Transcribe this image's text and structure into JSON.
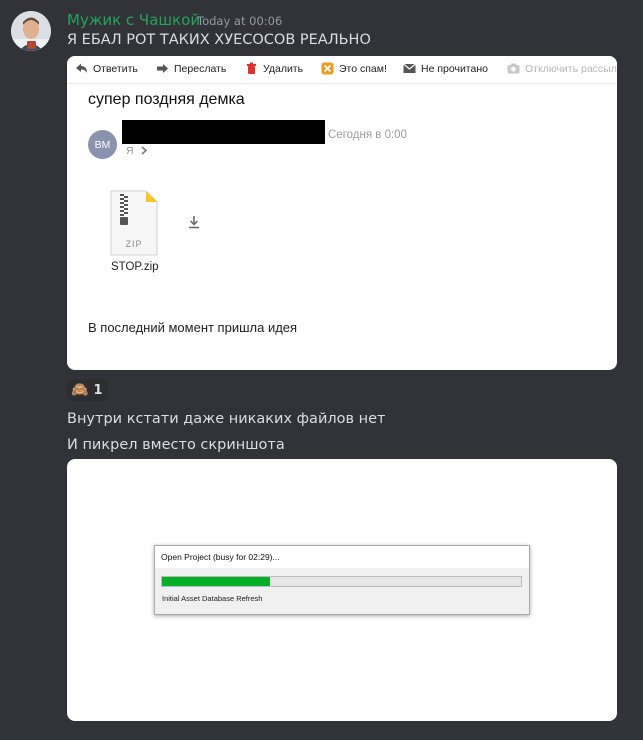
{
  "message": {
    "author": "Мужик с Чашкой",
    "timestamp": "Today at 00:06",
    "text_1": "Я ЕБАЛ РОТ ТАКИХ ХУЕСОСОВ РЕАЛЬНО",
    "text_2": "Внутри кстати даже никаких файлов нет",
    "text_3": "И пикрел вместо скриншота",
    "author_color": "#23a55a"
  },
  "email": {
    "toolbar": {
      "reply": "Ответить",
      "forward": "Переслать",
      "delete": "Удалить",
      "spam": "Это спам!",
      "unread": "Не прочитано",
      "unsubscribe": "Отключить рассыл"
    },
    "subject": "супер поздняя демка",
    "sender_initials": "BM",
    "date": "Сегодня в 0:00",
    "recipient": "Я",
    "attachment": {
      "name": "STOP.zip",
      "type_label": "ZIP"
    },
    "body": "В последний момент пришла идея"
  },
  "reaction": {
    "emoji": "🙈",
    "count": "1"
  },
  "dialog": {
    "title": "Open Project (busy for 02:29)...",
    "status": "Initial Asset Database Refresh",
    "progress": 0.3
  }
}
